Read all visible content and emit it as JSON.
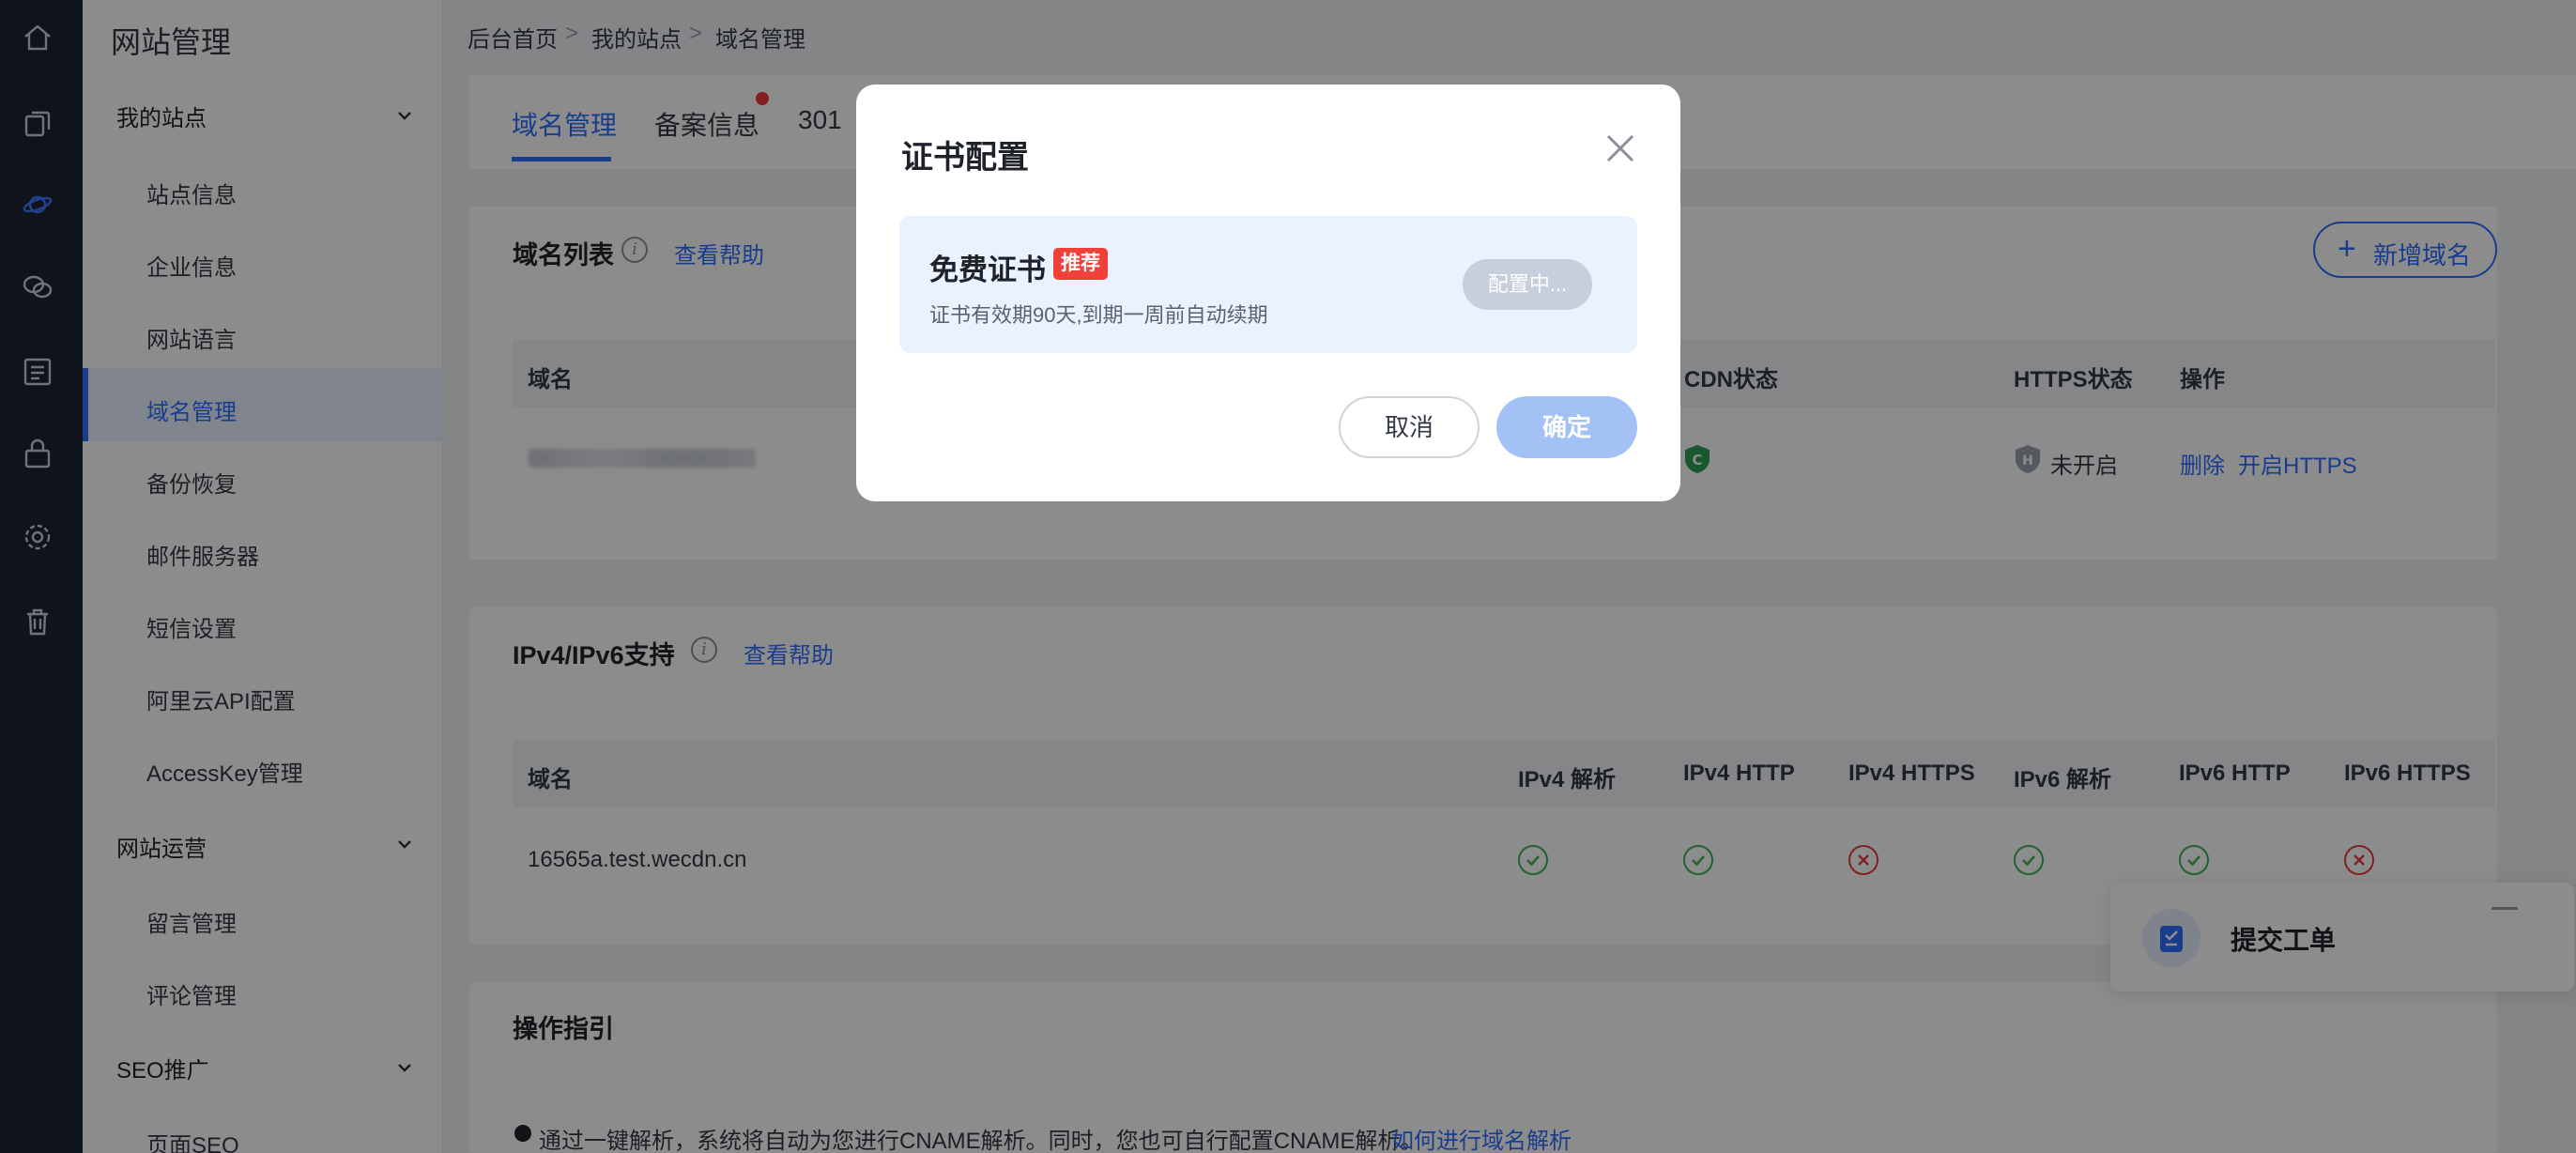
{
  "rail": {
    "icons": [
      "home-icon",
      "copy-icon",
      "planet-icon",
      "chat-icon",
      "list-icon",
      "bag-icon",
      "gear-icon",
      "trash-icon"
    ]
  },
  "sidebar": {
    "title": "网站管理",
    "groups": [
      {
        "label": "我的站点",
        "items": [
          "站点信息",
          "企业信息",
          "网站语言",
          "域名管理",
          "备份恢复",
          "邮件服务器",
          "短信设置",
          "阿里云API配置",
          "AccessKey管理"
        ]
      },
      {
        "label": "网站运营",
        "items": [
          "留言管理",
          "评论管理"
        ]
      },
      {
        "label": "SEO推广",
        "items": [
          "页面SEO"
        ]
      }
    ],
    "active_item": "域名管理"
  },
  "breadcrumb": [
    "后台首页",
    "我的站点",
    "域名管理"
  ],
  "tabs": [
    {
      "label": "域名管理"
    },
    {
      "label": "备案信息"
    },
    {
      "label": "301"
    }
  ],
  "domain_list": {
    "title": "域名列表",
    "help": "查看帮助",
    "add_button": "新增域名",
    "columns": {
      "domain": "域名",
      "cdn": "CDN状态",
      "https": "HTTPS状态",
      "ops": "操作"
    },
    "row": {
      "https_status": "未开启",
      "delete": "删除",
      "enable_https": "开启HTTPS"
    }
  },
  "ip_support": {
    "title": "IPv4/IPv6支持",
    "help": "查看帮助",
    "columns": [
      "域名",
      "IPv4 解析",
      "IPv4 HTTP",
      "IPv4 HTTPS",
      "IPv6 解析",
      "IPv6 HTTP",
      "IPv6 HTTPS"
    ],
    "row": {
      "domain": "16565a.test.wecdn.cn",
      "checks": [
        true,
        true,
        false,
        true,
        true,
        false
      ]
    }
  },
  "guide": {
    "title": "操作指引",
    "text": "通过一键解析，系统将自动为您进行CNAME解析。同时，您也可自行配置CNAME解析。",
    "link": "如何进行域名解析"
  },
  "float_widget": {
    "label": "提交工单"
  },
  "modal": {
    "title": "证书配置",
    "cert_title": "免费证书",
    "badge": "推荐",
    "cert_desc": "证书有效期90天,到期一周前自动续期",
    "config_button": "配置中...",
    "cancel": "取消",
    "confirm": "确定"
  },
  "colors": {
    "accent": "#2f6fff",
    "ok": "#3bb554",
    "error": "#e5403a",
    "badge": "#f0403a"
  }
}
